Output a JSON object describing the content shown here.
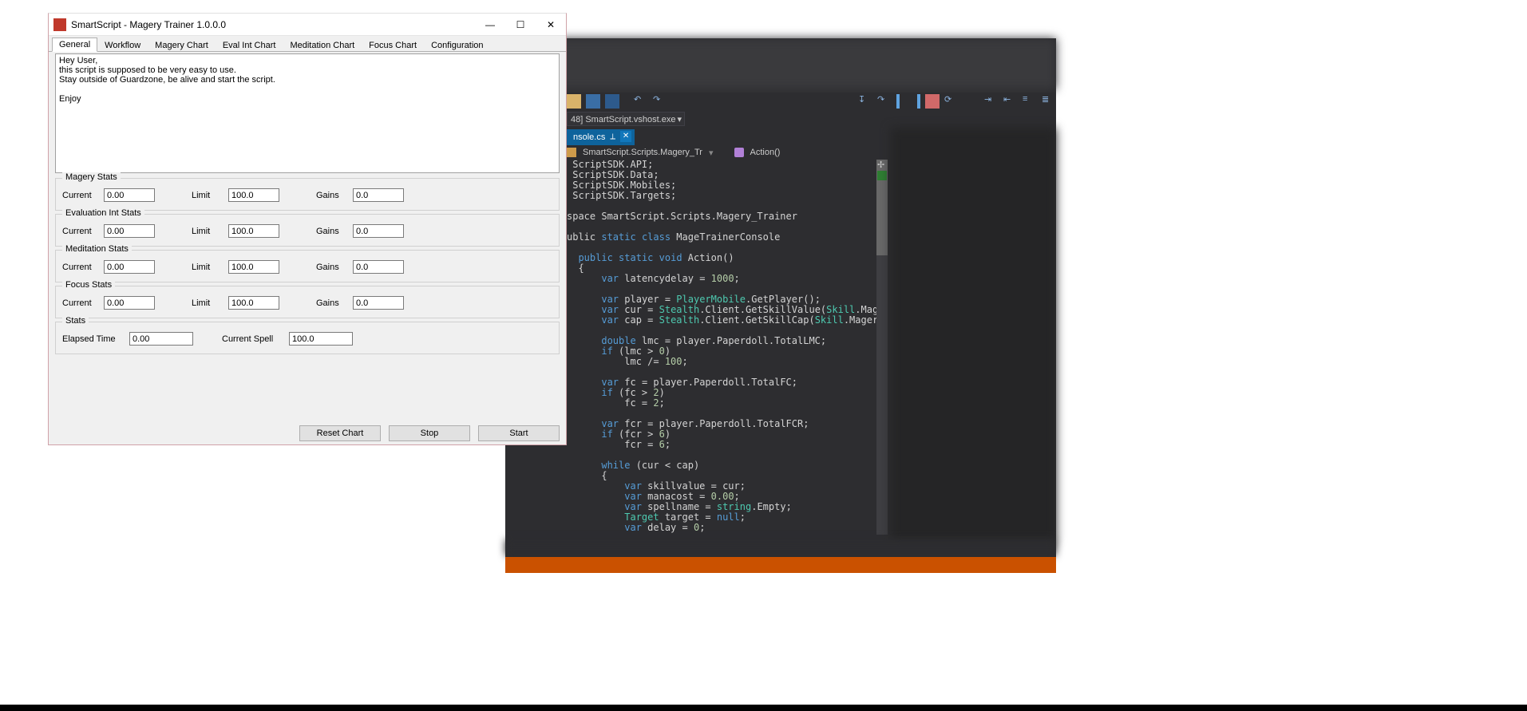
{
  "vs": {
    "process": "48] SmartScript.vshost.exe",
    "tab_file": "nsole.cs",
    "breadcrumb_class": "SmartScript.Scripts.Magery_Tr",
    "breadcrumb_method": "Action()",
    "code": " ScriptSDK.API;\n ScriptSDK.Data;\n ScriptSDK.Mobiles;\n ScriptSDK.Targets;\n\nspace SmartScript.Scripts.Magery_Trainer\n\nublic static class MageTrainerConsole\n\n  public static void Action()\n  {\n      var latencydelay = 1000;\n\n      var player = PlayerMobile.GetPlayer();\n      var cur = Stealth.Client.GetSkillValue(Skill.Magery);\n      var cap = Stealth.Client.GetSkillCap(Skill.Magery);\n\n      double lmc = player.Paperdoll.TotalLMC;\n      if (lmc > 0)\n          lmc /= 100;\n\n      var fc = player.Paperdoll.TotalFC;\n      if (fc > 2)\n          fc = 2;\n\n      var fcr = player.Paperdoll.TotalFCR;\n      if (fcr > 6)\n          fcr = 6;\n\n      while (cur < cap)\n      {\n          var skillvalue = cur;\n          var manacost = 0.00;\n          var spellname = string.Empty;\n          Target target = null;\n          var delay = 0;"
  },
  "app": {
    "title": "SmartScript - Magery Trainer 1.0.0.0",
    "tabs": [
      "General",
      "Workflow",
      "Magery Chart",
      "Eval Int Chart",
      "Meditation Chart",
      "Focus Chart",
      "Configuration"
    ],
    "active_tab_index": 0,
    "message": "Hey User,\nthis script is supposed to be very easy to use.\nStay outside of Guardzone, be alive and start the script.\n\nEnjoy",
    "groups": {
      "magery": {
        "title": "Magery Stats",
        "current": "0.00",
        "limit": "100.0",
        "gains": "0.0"
      },
      "evalint": {
        "title": "Evaluation Int Stats",
        "current": "0.00",
        "limit": "100.0",
        "gains": "0.0"
      },
      "meditation": {
        "title": "Meditation Stats",
        "current": "0.00",
        "limit": "100.0",
        "gains": "0.0"
      },
      "focus": {
        "title": "Focus Stats",
        "current": "0.00",
        "limit": "100.0",
        "gains": "0.0"
      }
    },
    "labels": {
      "current": "Current",
      "limit": "Limit",
      "gains": "Gains"
    },
    "stats": {
      "title": "Stats",
      "elapsed_label": "Elapsed Time",
      "spell_label": "Current Spell",
      "elapsed": "0.00",
      "spell": "100.0"
    },
    "buttons": {
      "reset": "Reset Chart",
      "stop": "Stop",
      "start": "Start"
    }
  }
}
